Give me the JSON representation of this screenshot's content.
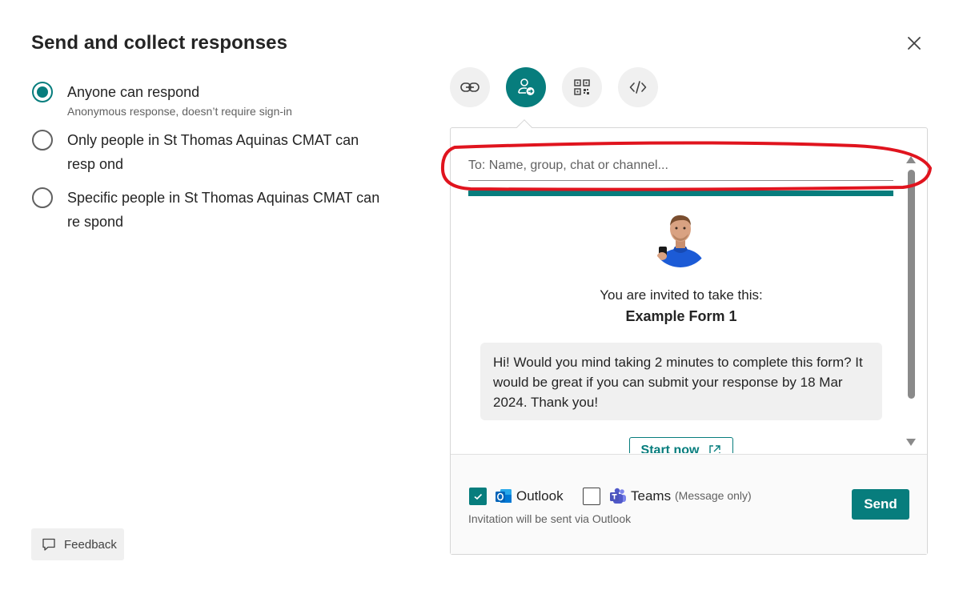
{
  "dialog": {
    "title": "Send and collect responses",
    "close_icon": "close-icon"
  },
  "options": [
    {
      "label": "Anyone can respond",
      "sub": "Anonymous response, doesn’t require sign-in",
      "selected": true
    },
    {
      "label": "Only people in St Thomas Aquinas CMAT can resp ond",
      "selected": false
    },
    {
      "label": "Specific people in St Thomas Aquinas CMAT can re spond",
      "selected": false
    }
  ],
  "feedback": {
    "label": "Feedback",
    "icon": "comment-icon"
  },
  "share_tabs": [
    {
      "name": "link",
      "icon": "link-icon",
      "active": false
    },
    {
      "name": "invite",
      "icon": "person-send-icon",
      "active": true
    },
    {
      "name": "qr",
      "icon": "qr-code-icon",
      "active": false
    },
    {
      "name": "embed",
      "icon": "code-icon",
      "active": false
    }
  ],
  "invite": {
    "to_placeholder": "To: Name, group, chat or channel...",
    "invited_text": "You are invited to take this:",
    "form_name": "Example Form 1",
    "message": "Hi! Would you mind taking 2 minutes to complete this form? It would be great if you can submit your response by 18 Mar 2024. Thank you!",
    "start_label": "Start now"
  },
  "footer": {
    "outlook_label": "Outlook",
    "outlook_checked": true,
    "teams_label": "Teams",
    "teams_checked": false,
    "teams_note": "(Message only)",
    "via_text": "Invitation will be sent via Outlook",
    "send_label": "Send"
  },
  "colors": {
    "accent": "#077d7d",
    "annotation": "#e0141e"
  }
}
